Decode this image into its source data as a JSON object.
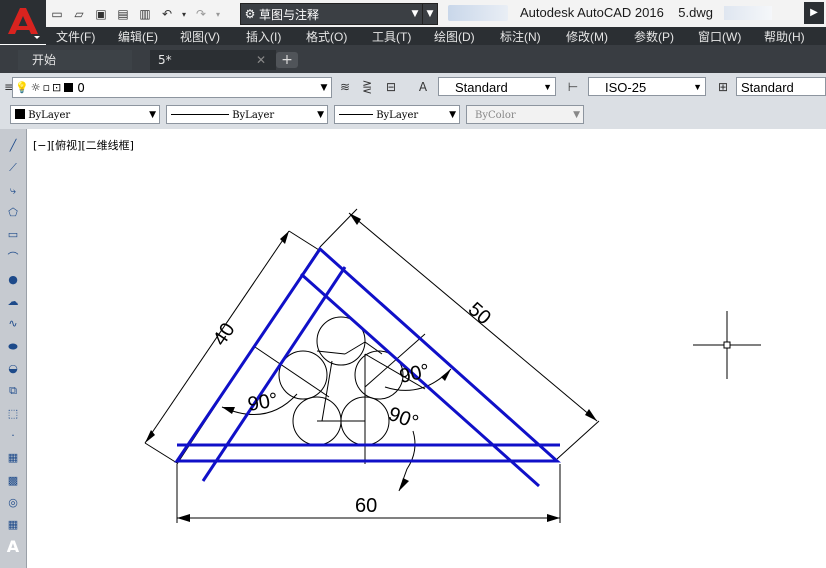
{
  "title_bar": {
    "workspace": "草图与注释",
    "app_title": "Autodesk AutoCAD 2016    5.dwg"
  },
  "menu": [
    "文件(F)",
    "编辑(E)",
    "视图(V)",
    "插入(I)",
    "格式(O)",
    "工具(T)",
    "绘图(D)",
    "标注(N)",
    "修改(M)",
    "参数(P)",
    "窗口(W)",
    "帮助(H)"
  ],
  "tabs": {
    "start": "开始",
    "doc": "5*",
    "close": "✕",
    "add": "+"
  },
  "toolbar1": {
    "layer": "0",
    "text_style": "Standard",
    "dim_style": "ISO-25",
    "table_style": "Standard"
  },
  "toolbar2": {
    "color": "ByLayer",
    "linetype": "ByLayer",
    "lineweight": "ByLayer",
    "plotstyle": "ByColor"
  },
  "viewport_label": "[−][俯视][二维线框]",
  "drawing": {
    "dim_left": "40",
    "dim_right": "50",
    "dim_bottom": "60",
    "angle_a": "90°",
    "angle_b": "90°",
    "angle_c": "90°",
    "line_color": "#1010c8"
  },
  "tool_icons": [
    "line-icon",
    "construction-line-icon",
    "polyline-icon",
    "polygon-icon",
    "rectangle-icon",
    "arc-icon",
    "circle-icon",
    "revision-cloud-icon",
    "spline-icon",
    "ellipse-icon",
    "ellipse-arc-icon",
    "insert-block-icon",
    "make-block-icon",
    "point-icon",
    "hatch-icon",
    "gradient-icon",
    "region-icon",
    "table-icon",
    "mtext-icon"
  ]
}
